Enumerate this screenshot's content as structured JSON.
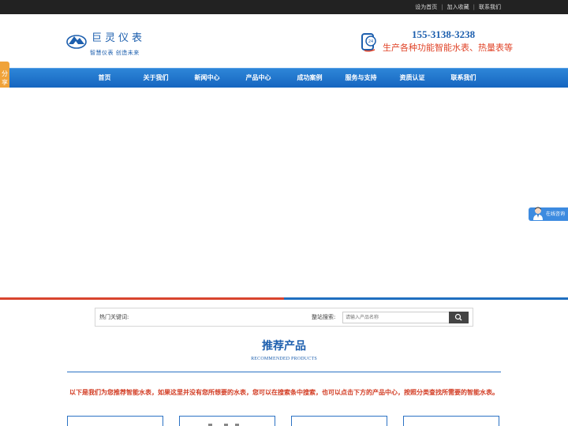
{
  "top_links": [
    "设为首页",
    "加入收藏",
    "联系我们"
  ],
  "header": {
    "brand_name": "巨灵仪表",
    "slogan": "智慧仪表  创造未来",
    "phone_number": "155-3138-3238",
    "phone_subtitle": "生产各种功能智能水表、热量表等"
  },
  "nav": [
    "首页",
    "关于我们",
    "新闻中心",
    "产品中心",
    "成功案例",
    "服务与支持",
    "资质认证",
    "联系我们"
  ],
  "share_tab": "分享",
  "online_service": "在线咨询",
  "search": {
    "hot_keywords_label": "热门关键词:",
    "site_search_label": "整站搜索:",
    "placeholder": "请输入产品名称"
  },
  "recommend": {
    "title": "推荐产品",
    "subtitle": "RECOMMENDED PRODUCTS",
    "intro": "以下是我们为您推荐智能水表，如果这里并没有您所想要的水表，您可以在搜索条中搜索，也可以点击下方的产品中心，按照分类查找所需要的智能水表。"
  },
  "colors": {
    "brand_blue": "#1d5fae",
    "nav_blue": "#1f6fc0",
    "accent_red": "#d8442e",
    "share_orange": "#f0a33a"
  }
}
